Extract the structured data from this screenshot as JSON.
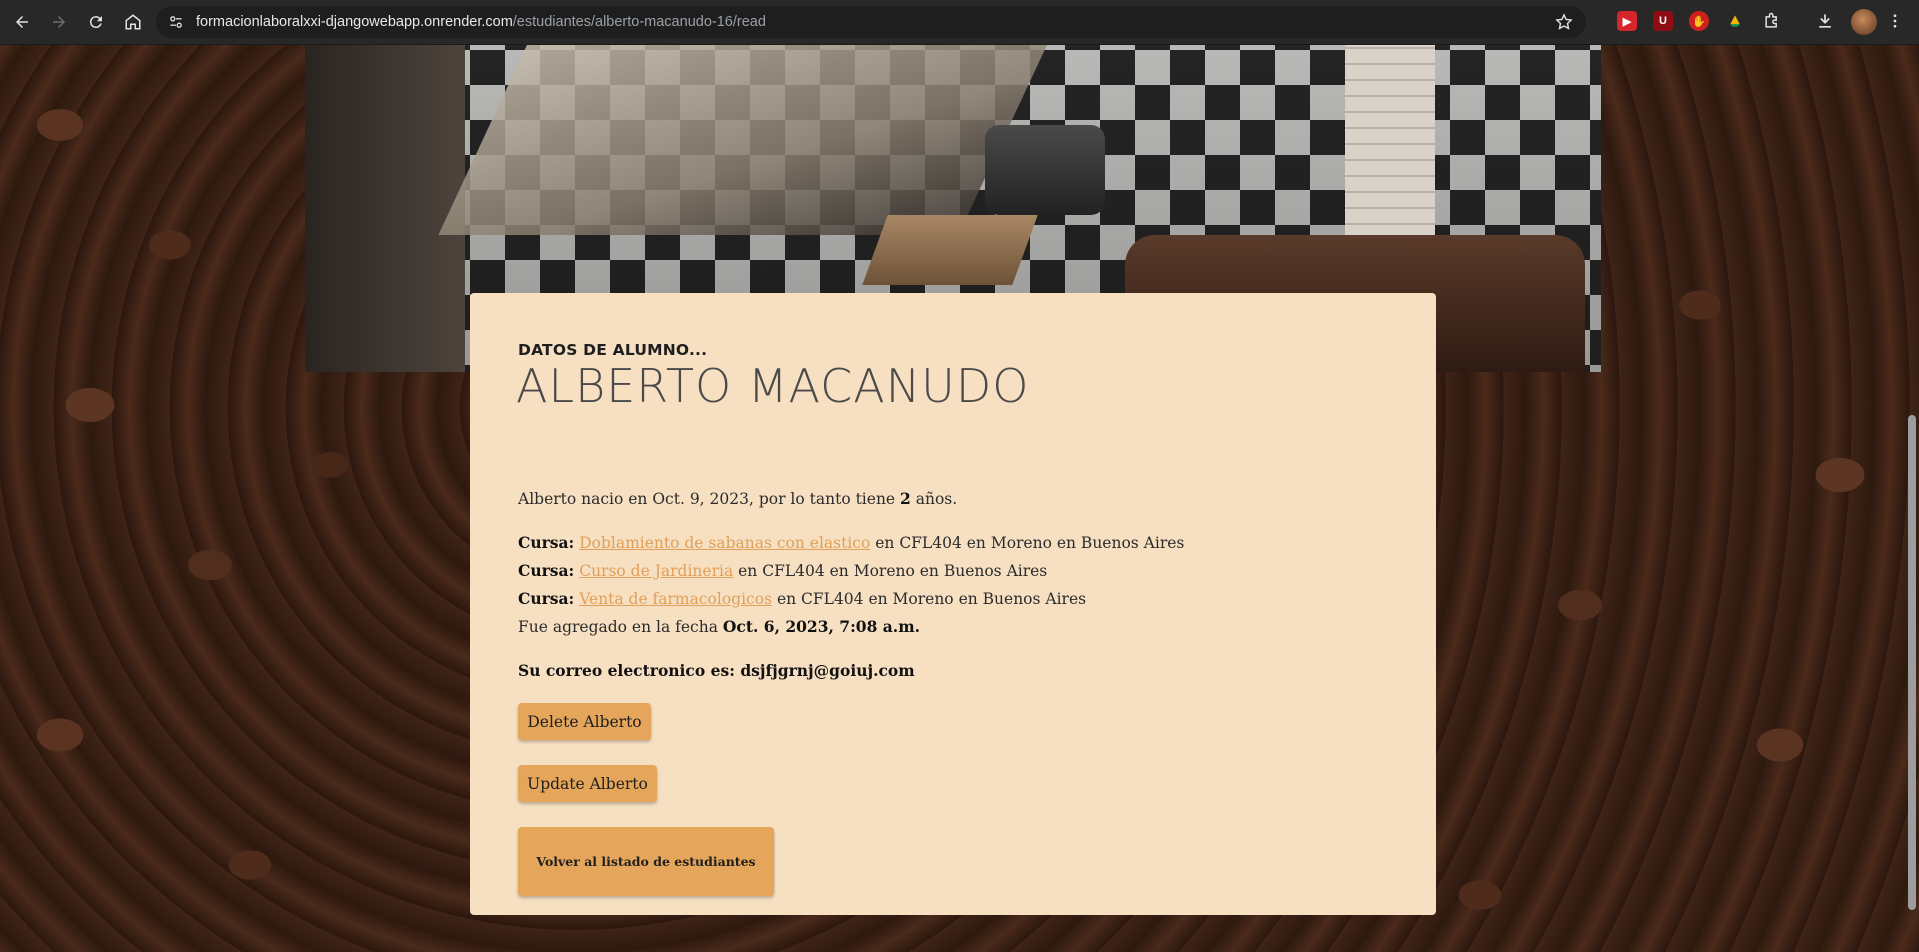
{
  "browser": {
    "url_host": "formacionlaboralxxi-djangowebapp.onrender.com",
    "url_path": "/estudiantes/alberto-macanudo-16/read",
    "extensions": [
      "youtube-ext-icon",
      "ublock-icon",
      "hand-ext-icon",
      "drive-ext-icon",
      "puzzle-icon"
    ]
  },
  "student": {
    "kicker": "DATOS DE ALUMNO...",
    "name": "ALBERTO MACANUDO",
    "birth_prefix": "Alberto nacio en Oct. 9, 2023, por lo tanto tiene ",
    "age": "2",
    "birth_suffix": " años.",
    "course_label": "Cursa:",
    "courses": [
      {
        "name": "Doblamiento de sabanas con elastico",
        "suffix": " en CFL404 en Moreno en Buenos Aires"
      },
      {
        "name": "Curso de Jardineria",
        "suffix": " en CFL404 en Moreno en Buenos Aires"
      },
      {
        "name": "Venta de farmacologicos",
        "suffix": " en CFL404 en Moreno en Buenos Aires"
      }
    ],
    "added_prefix": "Fue agregado en la fecha ",
    "added_date": "Oct. 6, 2023, 7:08 a.m.",
    "email_line": "Su correo electronico es: dsjfjgrnj@goiuj.com"
  },
  "actions": {
    "delete_label": "Delete Alberto",
    "update_label": "Update Alberto",
    "back_label": "Volver al listado de estudiantes"
  },
  "colors": {
    "card_bg": "#f7e0c2",
    "button_bg": "#e5a55a",
    "link": "#e0a05a"
  }
}
